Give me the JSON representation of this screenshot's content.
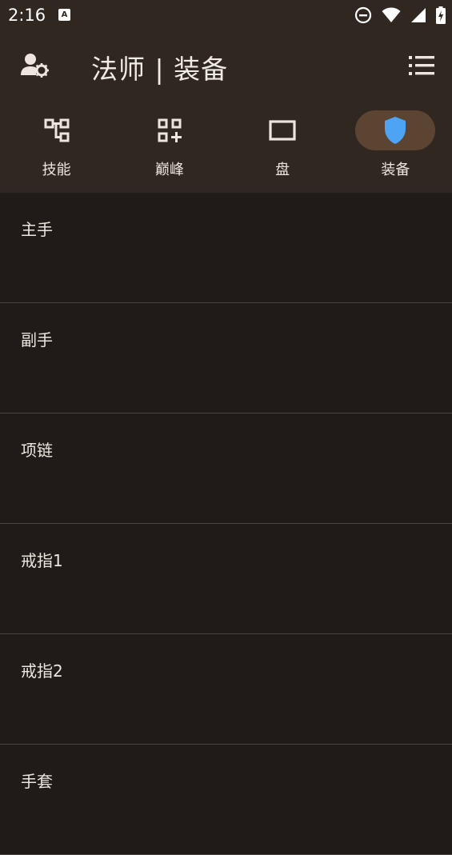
{
  "status_bar": {
    "time": "2:16",
    "notification_letter": "A"
  },
  "app_bar": {
    "title": "法师 | 装备",
    "account_icon": "account-settings-icon",
    "menu_icon": "list-menu-icon"
  },
  "tabs": [
    {
      "label": "技能",
      "icon": "skill-tree-icon",
      "active": false
    },
    {
      "label": "巅峰",
      "icon": "grid-add-icon",
      "active": false
    },
    {
      "label": "盘",
      "icon": "board-rectangle-icon",
      "active": false
    },
    {
      "label": "装备",
      "icon": "shield-icon",
      "active": true
    }
  ],
  "equipment_slots": [
    {
      "label": "主手"
    },
    {
      "label": "副手"
    },
    {
      "label": "项链"
    },
    {
      "label": "戒指1"
    },
    {
      "label": "戒指2"
    },
    {
      "label": "手套"
    }
  ],
  "colors": {
    "header_bg": "#302720",
    "body_bg": "#201b18",
    "active_pill": "#5b4532",
    "shield_accent": "#4ea3f5",
    "divider": "#4a4440"
  }
}
